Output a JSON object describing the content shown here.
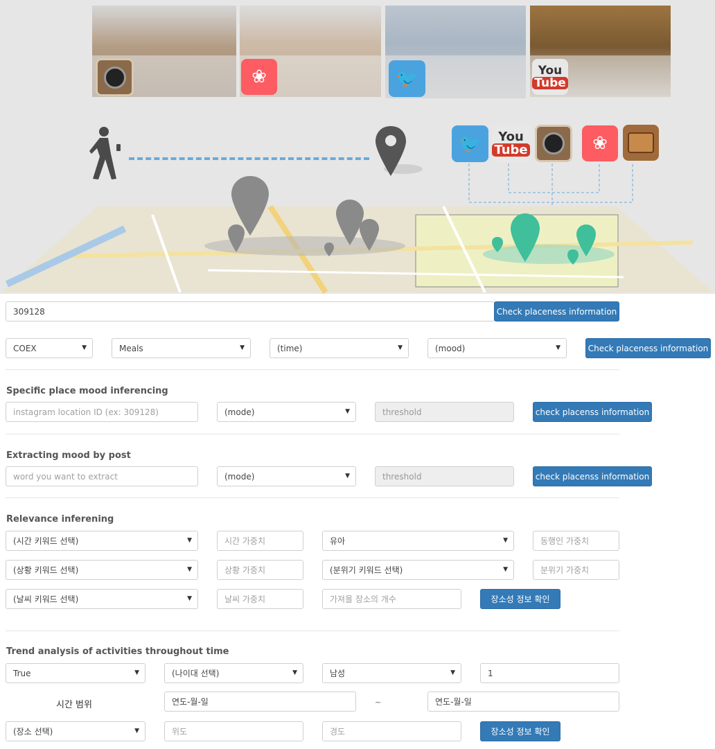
{
  "hero": {
    "photos": [
      {
        "name": "hanok-photo",
        "color": "#b8a08a",
        "social": "instagram"
      },
      {
        "name": "cathedral-photo",
        "color": "#c9b6a3",
        "social": "airbnb"
      },
      {
        "name": "cooking-photo",
        "color": "#b6c2cf",
        "social": "twitter"
      },
      {
        "name": "stage-photo",
        "color": "#8f6b3a",
        "social": "youtube"
      }
    ],
    "icons": {
      "youtube_top": "You",
      "youtube_bottom": "Tube"
    },
    "colors": {
      "route": "#6aaadb",
      "pin_gray": "#8a8a8a",
      "pin_teal": "#3fbf9a",
      "twitter": "#4aa3df",
      "airbnb": "#fd5c63",
      "instagram": "#8a6a4a",
      "wallet": "#a06a3a"
    }
  },
  "row1": {
    "location_id_value": "309128",
    "button": "Check placeness information"
  },
  "row2": {
    "place": "COEX",
    "category": "Meals",
    "time": "(time)",
    "mood": "(mood)",
    "button": "Check placeness information"
  },
  "section_mood": {
    "title": "Specific place mood inferencing",
    "input_placeholder": "instagram location ID (ex: 309128)",
    "mode": "(mode)",
    "threshold_placeholder": "threshold",
    "button": "check placenss information"
  },
  "section_extract": {
    "title": "Extracting mood by post",
    "input_placeholder": "word you want to extract",
    "mode": "(mode)",
    "threshold_placeholder": "threshold",
    "button": "check placenss information"
  },
  "section_relevance": {
    "title": "Relevance inferening",
    "time_keyword": "(시간 키워드 선택)",
    "time_weight_placeholder": "시간 가중치",
    "companion": "유아",
    "companion_weight_placeholder": "동행인 가중치",
    "situation_keyword": "(상황 키워드 선택)",
    "situation_weight_placeholder": "상황 가중치",
    "mood_keyword": "(분위기 키워드 선택)",
    "mood_weight_placeholder": "분위기 가중치",
    "weather_keyword": "(날씨 키워드 선택)",
    "weather_weight_placeholder": "날씨 가중치",
    "count_placeholder": "가져올 장소의 개수",
    "button": "장소성 정보 확인"
  },
  "section_trend": {
    "title": "Trend analysis of activities throughout time",
    "flag": "True",
    "age": "(나이대 선택)",
    "gender": "남성",
    "number_value": "1",
    "time_range_label": "시간 범위",
    "date_from": "연도-월-일",
    "tilde": "~",
    "date_to": "연도-월-일",
    "place": "(장소 선택)",
    "lat_placeholder": "위도",
    "lng_placeholder": "경도",
    "button": "장소성 정보 확인"
  }
}
